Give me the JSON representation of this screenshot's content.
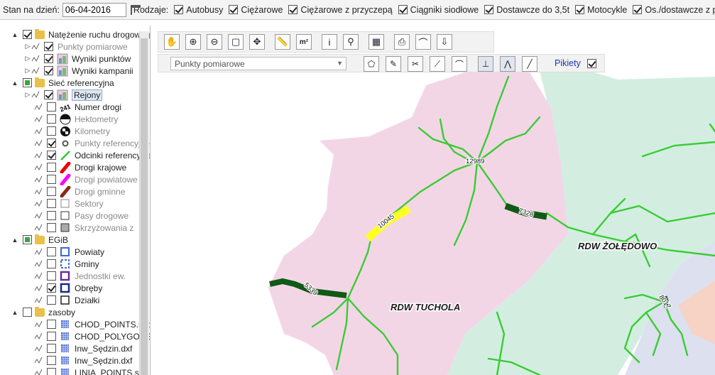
{
  "topbar": {
    "date_label": "Stan na dzień:",
    "date_value": "06-04-2016",
    "kinds_label": "Rodzaje:",
    "kinds": [
      {
        "label": "Autobusy",
        "checked": true
      },
      {
        "label": "Ciężarowe",
        "checked": true
      },
      {
        "label": "Ciężarowe z przyczepą",
        "checked": true
      },
      {
        "label": "Ciągniki siodłowe",
        "checked": true
      },
      {
        "label": "Dostawcze do 3,5t",
        "checked": true
      },
      {
        "label": "Motocykle",
        "checked": true
      },
      {
        "label": "Os./dostawcze z przyczepą",
        "checked": true
      }
    ]
  },
  "tree": {
    "items": [
      {
        "label": "Natężenie ruchu drogowego",
        "checked": true,
        "type": "folder"
      },
      {
        "label": "Punkty pomiarowe",
        "checked": true,
        "grey": true
      },
      {
        "label": "Wyniki punktów",
        "checked": true
      },
      {
        "label": "Wyniki kampanii",
        "checked": true
      },
      {
        "label": "Sieć referencyjna",
        "checked": "partial",
        "type": "folder"
      },
      {
        "label": "Rejony",
        "checked": true,
        "selected": true
      },
      {
        "label": "Numer drogi",
        "checked": false
      },
      {
        "label": "Hektometry",
        "checked": false,
        "grey": true
      },
      {
        "label": "Kilometry",
        "checked": false,
        "grey": true
      },
      {
        "label": "Punkty referencyjne",
        "checked": true,
        "grey": true
      },
      {
        "label": "Odcinki referencyjne",
        "checked": true
      },
      {
        "label": "Drogi krajowe",
        "checked": false
      },
      {
        "label": "Drogi powiatowe",
        "checked": false,
        "grey": true
      },
      {
        "label": "Drogi gminne",
        "checked": false,
        "grey": true
      },
      {
        "label": "Sektory",
        "checked": false,
        "grey": true
      },
      {
        "label": "Pasy drogowe",
        "checked": false,
        "grey": true
      },
      {
        "label": "Skrzyżowania z",
        "checked": false,
        "grey": true
      },
      {
        "label": "EGiB",
        "checked": "partial",
        "type": "folder"
      },
      {
        "label": "Powiaty",
        "checked": false
      },
      {
        "label": "Gminy",
        "checked": false
      },
      {
        "label": "Jednostki ew.",
        "checked": false,
        "grey": true
      },
      {
        "label": "Obręby",
        "checked": true
      },
      {
        "label": "Działki",
        "checked": false
      },
      {
        "label": "zasoby",
        "checked": false,
        "type": "folder"
      },
      {
        "label": "CHOD_POINTS.shp",
        "checked": false
      },
      {
        "label": "CHOD_POLYGONS",
        "checked": false
      },
      {
        "label": "Inw_Sędzin.dxf",
        "checked": false
      },
      {
        "label": "Inw_Sędzin.dxf",
        "checked": false
      },
      {
        "label": "LINIA_POINTS.shp",
        "checked": false
      }
    ]
  },
  "toolbar": {
    "layer_select": "Punkty pomiarowe",
    "pikiety_label": "Pikiety",
    "pikiety_checked": true
  },
  "map": {
    "region_labels": [
      "RDW TUCHOLA",
      "RDW ŻOŁĘDOWO"
    ],
    "road_labels": [
      "10045",
      "12989",
      "7328",
      "5339",
      "8017"
    ]
  },
  "colors": {
    "tuchola_region": "#f3d6e6",
    "zoledowo_region": "#d3eee1",
    "road_lines": "#39cc33",
    "highlight_road": "#ffff22",
    "dark_road": "#0f5a14"
  }
}
